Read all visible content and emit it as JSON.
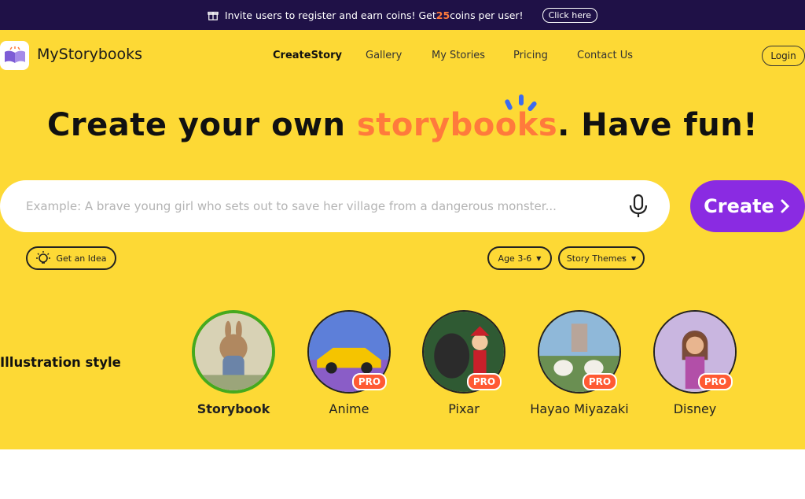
{
  "promo": {
    "text_before": "Invite users to register and earn coins! Get ",
    "highlight": "25",
    "text_after": " coins per user!",
    "cta": "Click here"
  },
  "brand": {
    "name": "MyStorybooks"
  },
  "nav": {
    "items": [
      {
        "label": "CreateStory",
        "active": true
      },
      {
        "label": "Gallery"
      },
      {
        "label": "My Stories"
      },
      {
        "label": "Pricing"
      },
      {
        "label": "Contact Us"
      }
    ],
    "login": "Login"
  },
  "hero": {
    "title_prefix": "Create your own ",
    "title_accent": "storybooks",
    "title_suffix": ". Have fun!"
  },
  "search": {
    "placeholder": "Example: A brave young girl who sets out to save her village from a dangerous monster...",
    "create_label": "Create"
  },
  "filters": {
    "idea": "Get an Idea",
    "age": "Age 3-6",
    "themes": "Story Themes"
  },
  "styles": {
    "label": "Illustration style",
    "pro_badge": "PRO",
    "items": [
      {
        "name": "Storybook",
        "selected": true
      },
      {
        "name": "Anime",
        "pro": true
      },
      {
        "name": "Pixar",
        "pro": true
      },
      {
        "name": "Hayao Miyazaki",
        "pro": true
      },
      {
        "name": "Disney",
        "pro": true
      }
    ]
  },
  "colors": {
    "hero_bg": "#fdd935",
    "accent": "#ff7a3c",
    "create_btn": "#8a2be2",
    "promo_bg": "#1f1147",
    "pro_badge": "#ff5a33"
  }
}
